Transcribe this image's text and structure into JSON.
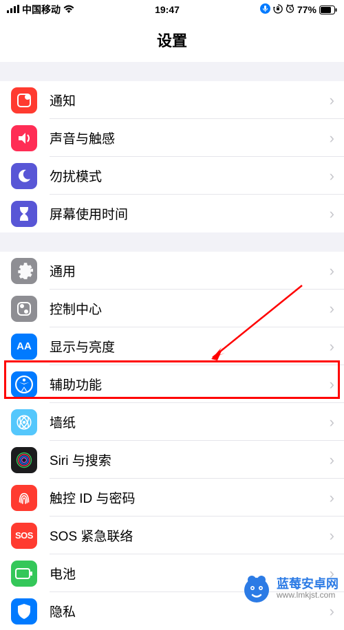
{
  "status": {
    "carrier": "中国移动",
    "time": "19:47",
    "battery_pct": "77%"
  },
  "header": {
    "title": "设置"
  },
  "groups": [
    {
      "items": [
        {
          "key": "notifications",
          "label": "通知",
          "icon": "notifications-icon",
          "bg": "#ff3b30"
        },
        {
          "key": "sounds",
          "label": "声音与触感",
          "icon": "sounds-icon",
          "bg": "#ff2d55"
        },
        {
          "key": "dnd",
          "label": "勿扰模式",
          "icon": "dnd-icon",
          "bg": "#5856d6"
        },
        {
          "key": "screentime",
          "label": "屏幕使用时间",
          "icon": "screentime-icon",
          "bg": "#5856d6"
        }
      ]
    },
    {
      "items": [
        {
          "key": "general",
          "label": "通用",
          "icon": "general-icon",
          "bg": "#8e8e93"
        },
        {
          "key": "control-center",
          "label": "控制中心",
          "icon": "control-center-icon",
          "bg": "#8e8e93"
        },
        {
          "key": "display",
          "label": "显示与亮度",
          "icon": "display-icon",
          "bg": "#007aff"
        },
        {
          "key": "accessibility",
          "label": "辅助功能",
          "icon": "accessibility-icon",
          "bg": "#007aff"
        },
        {
          "key": "wallpaper",
          "label": "墙纸",
          "icon": "wallpaper-icon",
          "bg": "#54c7fc"
        },
        {
          "key": "siri",
          "label": "Siri 与搜索",
          "icon": "siri-icon",
          "bg": "#1c1c1e"
        },
        {
          "key": "touchid",
          "label": "触控 ID 与密码",
          "icon": "touchid-icon",
          "bg": "#ff3b30"
        },
        {
          "key": "sos",
          "label": "SOS 紧急联络",
          "icon": "sos-icon",
          "bg": "#ff3b30",
          "text_icon": "SOS"
        },
        {
          "key": "battery",
          "label": "电池",
          "icon": "battery-icon",
          "bg": "#34c759"
        },
        {
          "key": "privacy",
          "label": "隐私",
          "icon": "privacy-icon",
          "bg": "#007aff"
        }
      ]
    }
  ],
  "watermark": {
    "title": "蓝莓安卓网",
    "url": "www.lmkjst.com"
  }
}
